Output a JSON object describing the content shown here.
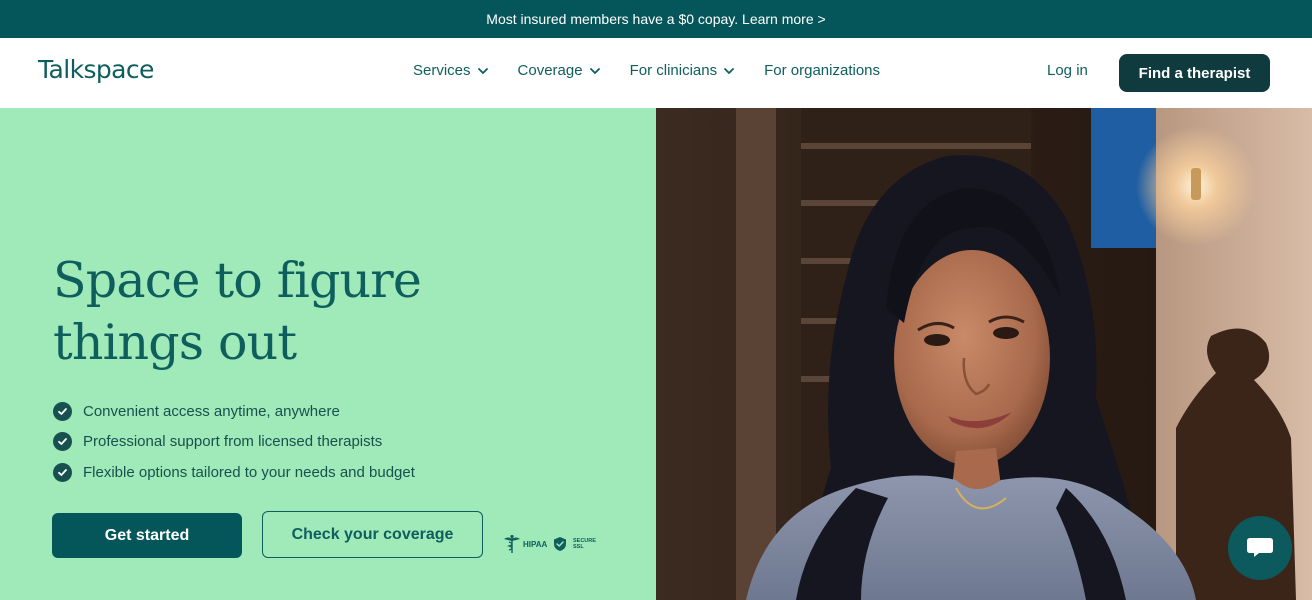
{
  "banner": {
    "text": "Most insured members have a $0 copay. Learn more >"
  },
  "nav": {
    "logo": "Talkspace",
    "menu": [
      {
        "label": "Services",
        "has_dropdown": true
      },
      {
        "label": "Coverage",
        "has_dropdown": true
      },
      {
        "label": "For clinicians",
        "has_dropdown": true
      },
      {
        "label": "For organizations",
        "has_dropdown": false
      }
    ],
    "login": "Log in",
    "cta": "Find a therapist"
  },
  "hero": {
    "headline_line1": "Space to figure",
    "headline_line2": "things out",
    "features": [
      "Convenient access anytime, anywhere",
      "Professional support from licensed therapists",
      "Flexible options tailored to your needs and budget"
    ],
    "primary_button": "Get started",
    "secondary_button": "Check your coverage",
    "badges": {
      "hipaa": "HIPAA",
      "ssl_line1": "SECURE",
      "ssl_line2": "SSL"
    },
    "image": "smiling-woman-photo"
  },
  "chat": {
    "icon": "chat-bubble-icon"
  },
  "colors": {
    "banner_bg": "#05565b",
    "hero_bg": "#a0e9b8",
    "brand_teal": "#0f5e5e",
    "dark_button": "#0f3a3e"
  }
}
